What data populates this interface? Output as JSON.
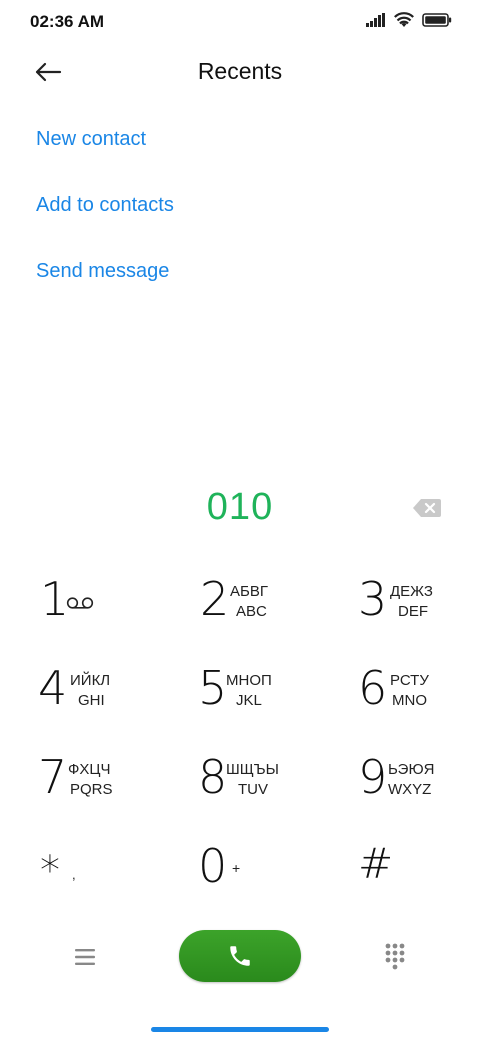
{
  "status_bar": {
    "time": "02:36 AM",
    "icons": [
      "signal-icon",
      "wifi-icon",
      "battery-icon"
    ]
  },
  "header": {
    "title": "Recents",
    "back_icon": "back-arrow-icon"
  },
  "actions": {
    "new_contact": "New contact",
    "add_to_contacts": "Add to contacts",
    "send_message": "Send message"
  },
  "dialer": {
    "number": "010",
    "backspace_icon": "backspace-icon"
  },
  "keypad": {
    "k1": {
      "digit": "1",
      "icon": "voicemail-icon"
    },
    "k2": {
      "digit": "2",
      "cyr": "АБВГ",
      "lat": "ABC"
    },
    "k3": {
      "digit": "3",
      "cyr": "ДЕЖЗ",
      "lat": "DEF"
    },
    "k4": {
      "digit": "4",
      "cyr": "ИЙКЛ",
      "lat": "GHI"
    },
    "k5": {
      "digit": "5",
      "cyr": "МНОП",
      "lat": "JKL"
    },
    "k6": {
      "digit": "6",
      "cyr": "РСТУ",
      "lat": "MNO"
    },
    "k7": {
      "digit": "7",
      "cyr": "ФХЦЧ",
      "lat": "PQRS"
    },
    "k8": {
      "digit": "8",
      "cyr": "ШЩЪЫ",
      "lat": "TUV"
    },
    "k9": {
      "digit": "9",
      "cyr": "ЬЭЮЯ",
      "lat": "WXYZ"
    },
    "kstar": {
      "digit": "*",
      "sub": ","
    },
    "k0": {
      "digit": "0",
      "sub": "+"
    },
    "khash": {
      "digit": "#"
    }
  },
  "bottom": {
    "menu_icon": "menu-icon",
    "call_icon": "phone-icon",
    "dialpad_icon": "dialpad-icon"
  },
  "colors": {
    "accent": "#1a86e6",
    "number": "#1fb35a",
    "call": "#2f9a20"
  }
}
